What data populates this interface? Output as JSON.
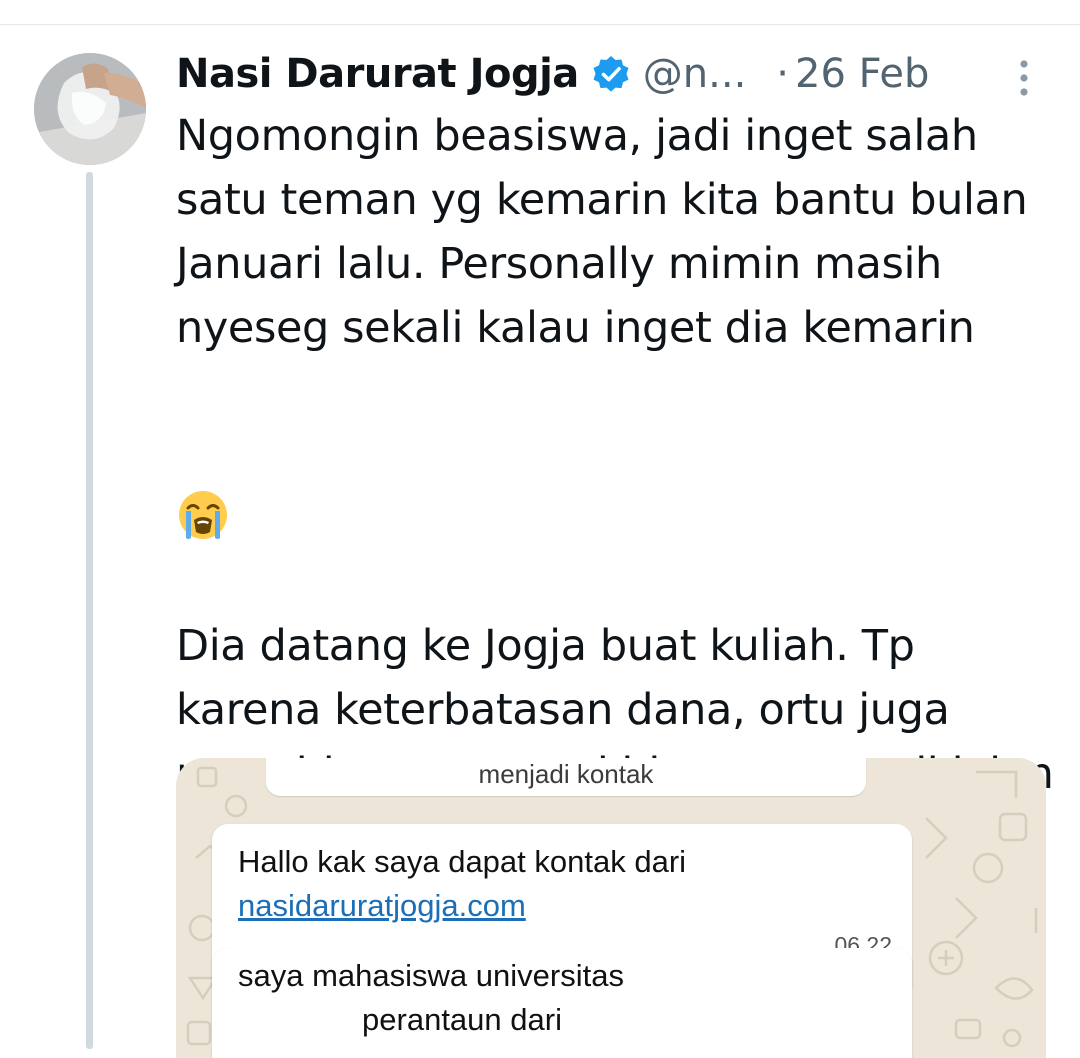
{
  "tweet": {
    "author": {
      "display_name": "Nasi Darurat Jogja",
      "handle": "@n...",
      "verified": true,
      "avatar_icon": "avatar-plastic-bag-hand"
    },
    "separator": "·",
    "date": "26 Feb",
    "more_icon": "more-vertical-icon",
    "text": {
      "paragraph_1": "Ngomongin beasiswa, jadi inget salah satu teman yg kemarin kita bantu bulan Januari lalu. Personally mimin masih nyeseg sekali kalau inget dia kemarin",
      "emoji": "😭",
      "emoji_icon": "loudly-crying-face-icon",
      "paragraph_2": "Dia datang ke Jogja buat kuliah. Tp karena keterbatasan dana, ortu juga ngga bisa support akhirnya putus di jalan & terlantar di Jogja -"
    },
    "media": {
      "system_message": "menjadi kontak",
      "messages": [
        {
          "text": "Hallo kak saya dapat kontak dari",
          "link": "nasidaruratjogja.com",
          "time": "06.22"
        },
        {
          "line1": "saya mahasiswa universitas",
          "line2": "perantaun dari"
        }
      ]
    }
  },
  "colors": {
    "text_primary": "#0f1419",
    "text_secondary": "#536471",
    "verified_blue": "#1d9bf0",
    "thread_line": "#cfd9de",
    "chat_background": "#ece5d8",
    "link_blue": "#1a6fb8"
  }
}
